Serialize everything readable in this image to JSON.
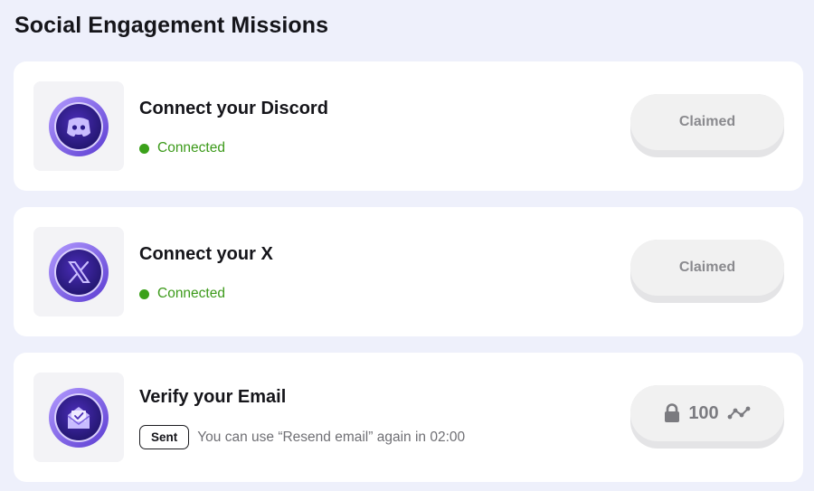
{
  "page": {
    "title": "Social Engagement Missions"
  },
  "missions": [
    {
      "icon": "discord-icon",
      "title": "Connect your Discord",
      "status": "Connected",
      "button": "Claimed"
    },
    {
      "icon": "x-icon",
      "title": "Connect your X",
      "status": "Connected",
      "button": "Claimed"
    },
    {
      "icon": "email-icon",
      "title": "Verify your Email",
      "badge": "Sent",
      "note": "You can use “Resend email” again in 02:00",
      "reward": {
        "icon": "lock-icon",
        "value": "100",
        "unit_icon": "points-icon"
      }
    }
  ],
  "colors": {
    "background": "#eef0fb",
    "card": "#ffffff",
    "connected": "#3ba11a",
    "accent_purple": "#5b3fd6",
    "button_face": "#f1f1f1",
    "button_text": "#8a8a8e"
  }
}
